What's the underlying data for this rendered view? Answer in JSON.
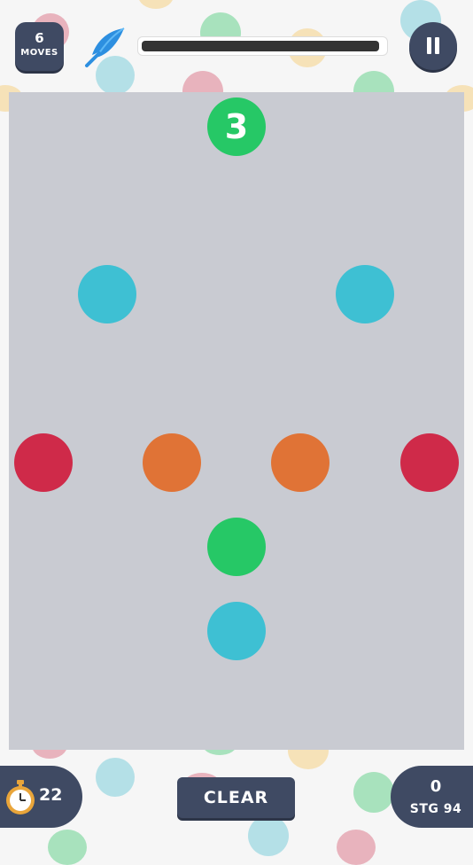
{
  "hud": {
    "moves_value": "6",
    "moves_label": "MOVES",
    "progress_fraction": 0.98,
    "timer_value": "22",
    "clear_label": "CLEAR",
    "score_value": "0",
    "stage_label": "STG 94"
  },
  "board": {
    "target_number": "3"
  },
  "colors": {
    "green": "#26c866",
    "cyan": "#3ec0d3",
    "red": "#cf2a49",
    "orange": "#e07336",
    "ui_dark": "#3f4a63",
    "board": "#c9cbd2"
  },
  "icons": [
    "feather-icon",
    "pause-icon",
    "stopwatch-icon"
  ]
}
